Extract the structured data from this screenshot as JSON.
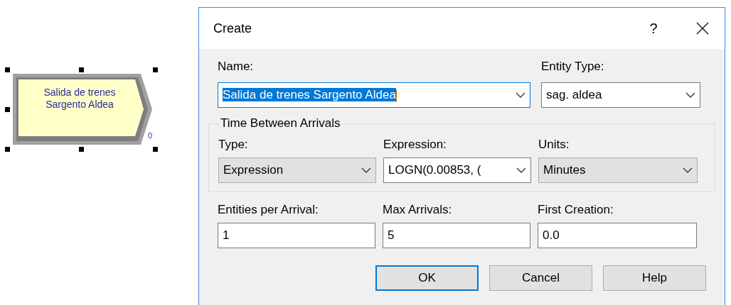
{
  "module": {
    "label_lines": [
      "Salida de trenes",
      "Sargento Aldea"
    ],
    "count": "0",
    "selected": true
  },
  "dialog": {
    "title": "Create",
    "help_glyph": "?",
    "name": {
      "label": "Name:",
      "value": "Salida de trenes Sargento Aldea",
      "highlighted": true,
      "focused": true
    },
    "entity_type": {
      "label": "Entity Type:",
      "value": "sag. aldea"
    },
    "group": {
      "title": "Time Between Arrivals",
      "fields": [
        {
          "label": "Type:",
          "value": "Expression",
          "kind": "list"
        },
        {
          "label": "Expression:",
          "value": "LOGN(0.00853, (",
          "kind": "editable"
        },
        {
          "label": "Units:",
          "value": "Minutes",
          "kind": "list"
        }
      ]
    },
    "fields": [
      {
        "label": "Entities per Arrival:",
        "value": "1"
      },
      {
        "label": "Max Arrivals:",
        "value": "5"
      },
      {
        "label": "First Creation:",
        "value": "0.0"
      }
    ],
    "buttons": [
      {
        "label": "OK",
        "default": true
      },
      {
        "label": "Cancel",
        "default": false
      },
      {
        "label": "Help",
        "default": false
      }
    ]
  }
}
